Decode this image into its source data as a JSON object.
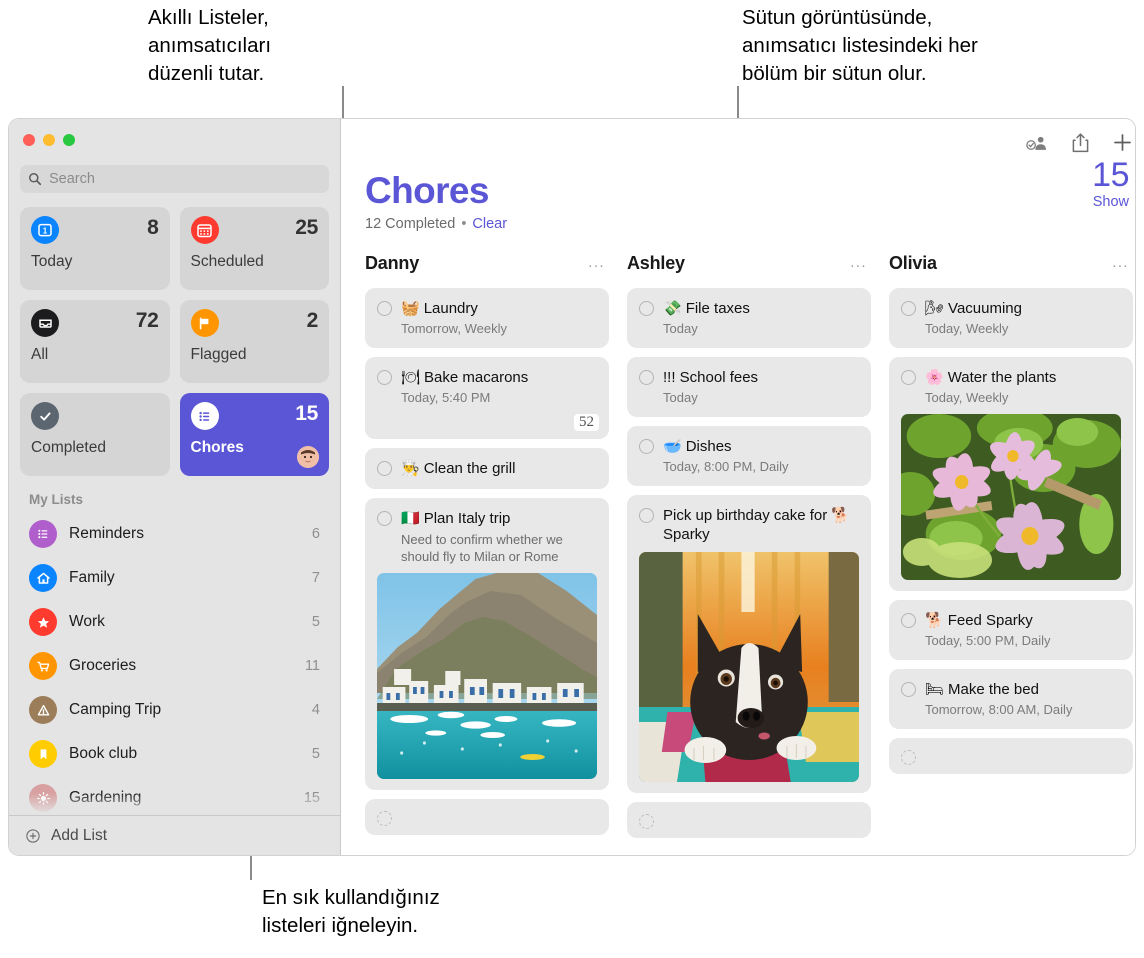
{
  "callouts": {
    "left": "Akıllı Listeler,\nanımsatıcıları\ndüzenli tutar.",
    "right": "Sütun görüntüsünde,\nanımsatıcı listesindeki her\nbölüm bir sütun olur.",
    "bottom": "En sık kullandığınız\nlisteleri iğneleyin."
  },
  "colors": {
    "accent": "#5a56d6",
    "sidebar_bg": "#e4e4e4",
    "card_bg": "#e8e8e8"
  },
  "window": {
    "traffic_lights": [
      "close-button",
      "minimize-button",
      "zoom-button"
    ]
  },
  "sidebar": {
    "search": {
      "placeholder": "Search",
      "value": ""
    },
    "smart_lists": [
      {
        "label": "Today",
        "count": "8",
        "icon": "calendar-today-icon",
        "color": "#0a84ff",
        "selected": false
      },
      {
        "label": "Scheduled",
        "count": "25",
        "icon": "calendar-icon",
        "color": "#ff3b30",
        "selected": false
      },
      {
        "label": "All",
        "count": "72",
        "icon": "inbox-icon",
        "color": "#1c1c1e",
        "selected": false
      },
      {
        "label": "Flagged",
        "count": "2",
        "icon": "flag-icon",
        "color": "#ff9500",
        "selected": false
      },
      {
        "label": "Completed",
        "count": "",
        "icon": "checkmark-icon",
        "color": "#5b6670",
        "selected": false
      },
      {
        "label": "Chores",
        "count": "15",
        "icon": "list-bullet-icon",
        "color": "#ffffff",
        "selected": true
      }
    ],
    "my_lists_header": "My Lists",
    "lists": [
      {
        "name": "Reminders",
        "count": "6",
        "icon": "list-bullet-icon",
        "color": "#b05ecb"
      },
      {
        "name": "Family",
        "count": "7",
        "icon": "house-icon",
        "color": "#0a84ff"
      },
      {
        "name": "Work",
        "count": "5",
        "icon": "star-icon",
        "color": "#ff3b30"
      },
      {
        "name": "Groceries",
        "count": "11",
        "icon": "cart-icon",
        "color": "#ff9500"
      },
      {
        "name": "Camping Trip",
        "count": "4",
        "icon": "tent-icon",
        "color": "#9b7d5a"
      },
      {
        "name": "Book club",
        "count": "5",
        "icon": "bookmark-icon",
        "color": "#ffcc00"
      },
      {
        "name": "Gardening",
        "count": "15",
        "icon": "sun-icon",
        "color": "#d8a0a0"
      }
    ],
    "add_list_label": "Add List"
  },
  "toolbar": {
    "share_people_icon": "add-person-icon",
    "share_icon": "share-icon",
    "add_icon": "plus-icon"
  },
  "main": {
    "title": "Chores",
    "completed_text": "12 Completed",
    "separator": "•",
    "clear_label": "Clear",
    "count": "15",
    "show_label": "Show",
    "columns": [
      {
        "name": "Danny",
        "menu": "...",
        "tasks": [
          {
            "emoji": "🧺",
            "title": "Laundry",
            "sub": "Tomorrow, Weekly"
          },
          {
            "emoji": "🍽",
            "title": "Bake macarons",
            "sub": "Today, 5:40 PM",
            "badge": "52"
          },
          {
            "emoji": "👨‍🍳",
            "title": "Clean the grill"
          },
          {
            "emoji": "🇮🇹",
            "title": "Plan Italy trip",
            "note": "Need to confirm whether we should fly to Milan or Rome",
            "photo": "italy-coast-photo"
          },
          {
            "empty": true
          }
        ]
      },
      {
        "name": "Ashley",
        "menu": "...",
        "tasks": [
          {
            "emoji": "💸",
            "title": "File taxes",
            "sub": "Today"
          },
          {
            "emoji": "",
            "title": "!!! School fees",
            "sub": "Today"
          },
          {
            "emoji": "🥣",
            "title": "Dishes",
            "sub": "Today, 8:00 PM, Daily"
          },
          {
            "emoji": "",
            "title": "Pick up birthday cake for 🐕 Sparky",
            "photo": "dog-photo"
          },
          {
            "empty": true
          }
        ]
      },
      {
        "name": "Olivia",
        "menu": "...",
        "tasks": [
          {
            "emoji": "🌬",
            "title": "Vacuuming",
            "sub": "Today, Weekly"
          },
          {
            "emoji": "🌸",
            "title": "Water the plants",
            "sub": "Today, Weekly",
            "photo": "flowers-photo"
          },
          {
            "emoji": "🐕",
            "title": "Feed Sparky",
            "sub": "Today, 5:00 PM, Daily"
          },
          {
            "emoji": "🛏",
            "title": "Make the bed",
            "sub": "Tomorrow, 8:00 AM, Daily"
          },
          {
            "empty": true
          }
        ]
      }
    ]
  }
}
